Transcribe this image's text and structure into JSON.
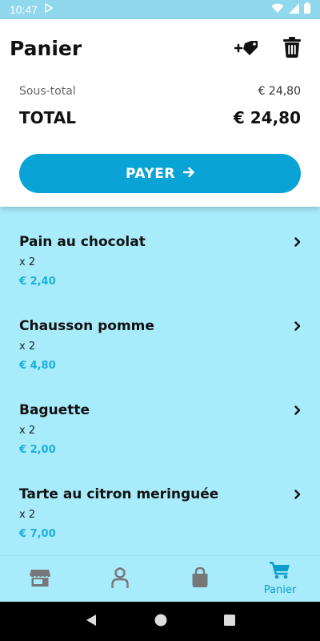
{
  "status_bar": {
    "time": "10:47"
  },
  "header": {
    "title": "Panier"
  },
  "summary": {
    "subtotal_label": "Sous-total",
    "subtotal_value": "€ 24,80",
    "total_label": "TOTAL",
    "total_value": "€ 24,80"
  },
  "pay_button": {
    "label": "PAYER"
  },
  "cart": {
    "items": [
      {
        "name": "Pain au chocolat",
        "quantity": "x 2",
        "price": "€ 2,40"
      },
      {
        "name": "Chausson pomme",
        "quantity": "x 2",
        "price": "€ 4,80"
      },
      {
        "name": "Baguette",
        "quantity": "x 2",
        "price": "€ 2,00"
      },
      {
        "name": "Tarte au citron meringuée",
        "quantity": "x 2",
        "price": "€ 7,00"
      }
    ]
  },
  "bottom_nav": {
    "items": [
      {
        "icon": "store-icon",
        "label": ""
      },
      {
        "icon": "person-icon",
        "label": ""
      },
      {
        "icon": "shopping-bag-icon",
        "label": ""
      },
      {
        "icon": "cart-icon",
        "label": "Panier",
        "active": true
      }
    ]
  },
  "colors": {
    "accent": "#0aa3d6",
    "list_background": "#a8ebfb",
    "status_bar": "#8fd8ee",
    "price": "#1ab0dc"
  }
}
